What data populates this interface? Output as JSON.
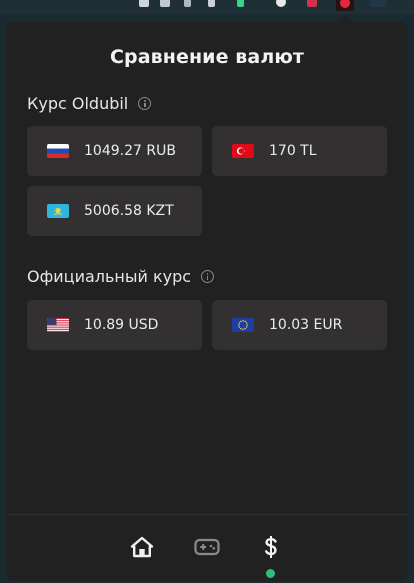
{
  "popup": {
    "title": "Сравнение валют"
  },
  "sections": {
    "oldubil": {
      "heading": "Курс Oldubil",
      "info_icon": "info-icon",
      "cards": [
        {
          "currency": "RUB",
          "flag": "flag-russia",
          "text": "1049.27 RUB"
        },
        {
          "currency": "TL",
          "flag": "flag-turkey",
          "text": "170 TL"
        },
        {
          "currency": "KZT",
          "flag": "flag-kazakhstan",
          "text": "5006.58 KZT"
        }
      ]
    },
    "official": {
      "heading": "Официальный курс",
      "info_icon": "info-icon",
      "cards": [
        {
          "currency": "USD",
          "flag": "flag-usa",
          "text": "10.89 USD"
        },
        {
          "currency": "EUR",
          "flag": "flag-eu",
          "text": "10.03 EUR"
        }
      ]
    }
  },
  "bottom_nav": {
    "items": [
      {
        "icon": "home-icon",
        "active": false
      },
      {
        "icon": "gamepad-icon",
        "active": false
      },
      {
        "icon": "dollar-icon",
        "active": true
      }
    ],
    "active_indicator_color": "#2ebf7f"
  },
  "colors": {
    "popup_bg": "#222122",
    "card_bg": "#323031",
    "text": "#ececec",
    "accent_green": "#2ebf7f"
  }
}
